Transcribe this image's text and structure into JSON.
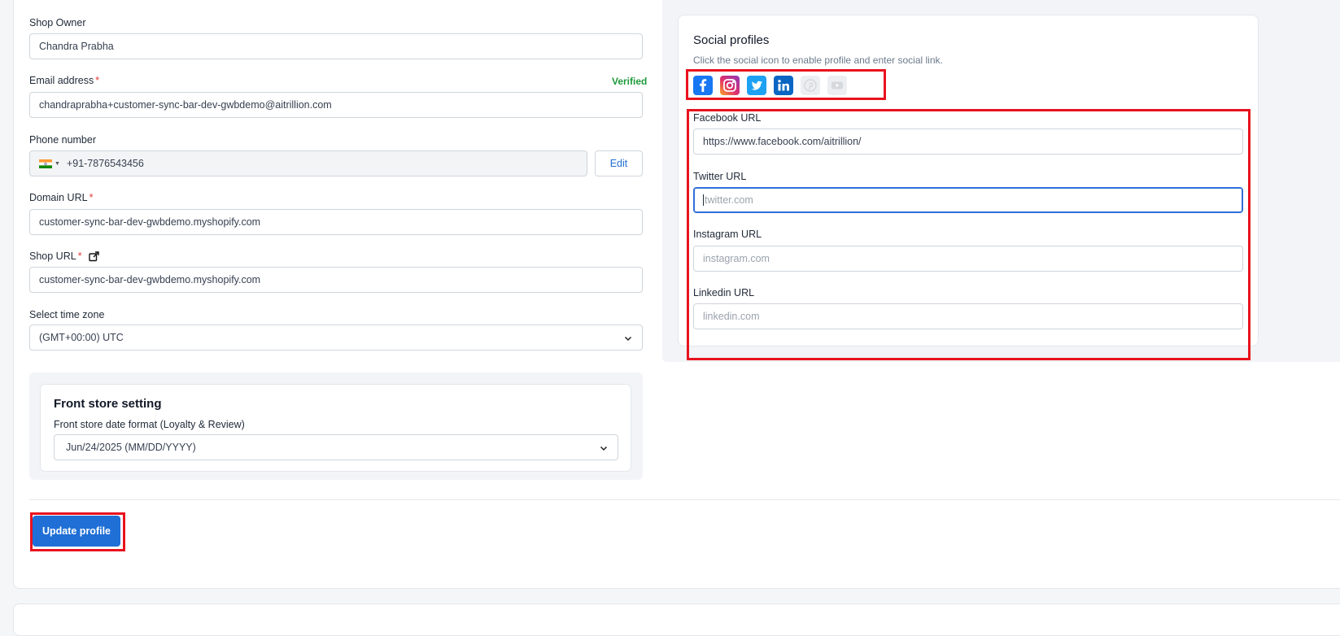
{
  "colors": {
    "primary": "#1f6fd6",
    "verified": "#1e9a3b",
    "required": "#e53935",
    "highlight": "#e8131f"
  },
  "form": {
    "shop_owner": {
      "label": "Shop Owner",
      "value": "Chandra Prabha"
    },
    "email": {
      "label": "Email address",
      "required_mark": "*",
      "status": "Verified",
      "value": "chandraprabha+customer-sync-bar-dev-gwbdemo@aitrillion.com"
    },
    "phone": {
      "label": "Phone number",
      "country_flag": "india-flag-icon",
      "value": "+91-7876543456",
      "edit_label": "Edit"
    },
    "domain_url": {
      "label": "Domain URL",
      "required_mark": "*",
      "value": "customer-sync-bar-dev-gwbdemo.myshopify.com"
    },
    "shop_url": {
      "label": "Shop URL",
      "required_mark": "*",
      "value": "customer-sync-bar-dev-gwbdemo.myshopify.com"
    },
    "time_zone": {
      "label": "Select time zone",
      "value": "(GMT+00:00) UTC"
    }
  },
  "front_store": {
    "title": "Front store setting",
    "date_format_label": "Front store date format (Loyalty & Review)",
    "date_format_value": "Jun/24/2025 (MM/DD/YYYY)"
  },
  "social": {
    "title": "Social profiles",
    "subtitle": "Click the social icon to enable profile and enter social link.",
    "icons": [
      {
        "name": "facebook-icon",
        "enabled": true,
        "color": "#1877f2"
      },
      {
        "name": "instagram-icon",
        "enabled": true,
        "color": "#e1306c"
      },
      {
        "name": "twitter-icon",
        "enabled": true,
        "color": "#1da1f2"
      },
      {
        "name": "linkedin-icon",
        "enabled": true,
        "color": "#0a66c2"
      },
      {
        "name": "pinterest-icon",
        "enabled": false,
        "color": "#e5e7eb"
      },
      {
        "name": "youtube-icon",
        "enabled": false,
        "color": "#e5e7eb"
      }
    ],
    "fields": {
      "facebook": {
        "label": "Facebook URL",
        "value": "https://www.facebook.com/aitrillion/"
      },
      "twitter": {
        "label": "Twitter URL",
        "placeholder": "twitter.com"
      },
      "instagram": {
        "label": "Instagram URL",
        "placeholder": "instagram.com"
      },
      "linkedin": {
        "label": "Linkedin URL",
        "placeholder": "linkedin.com"
      }
    }
  },
  "actions": {
    "update_label": "Update profile"
  }
}
